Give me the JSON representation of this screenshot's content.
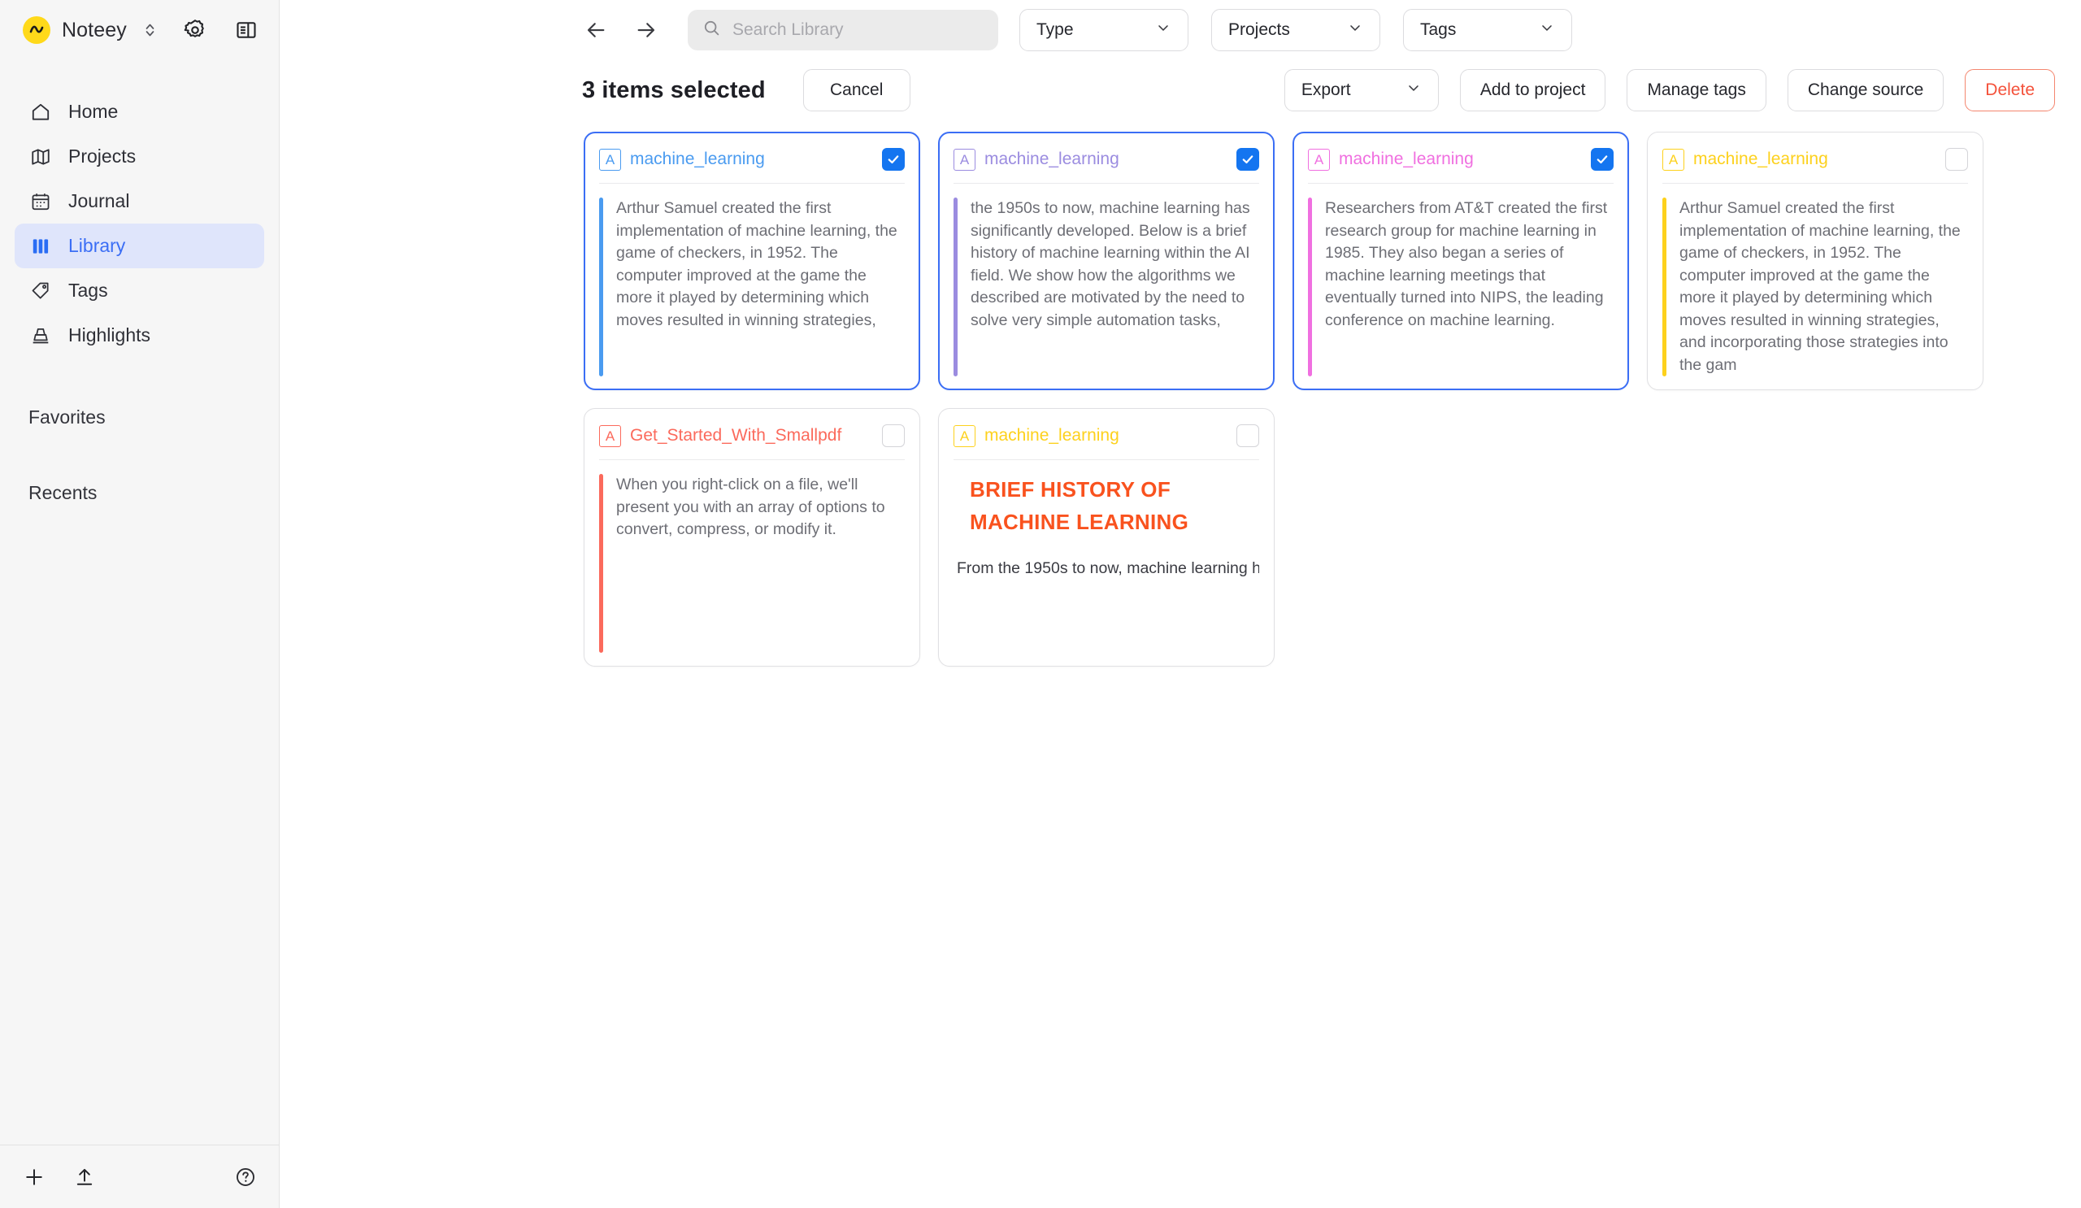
{
  "app": {
    "brand": "Noteey",
    "icons": {
      "brand_logo": "squiggle-logo",
      "brand_switcher": "chevron-up-down-icon",
      "settings": "gear-icon",
      "panel": "toggle-panel-icon",
      "back": "arrow-left-icon",
      "forward": "arrow-right-icon",
      "search": "search-icon",
      "add": "plus-icon",
      "import": "upload-icon",
      "help": "help-circle-icon"
    }
  },
  "sidebar": {
    "items": [
      {
        "label": "Home",
        "icon": "home-icon",
        "active": false
      },
      {
        "label": "Projects",
        "icon": "map-icon",
        "active": false
      },
      {
        "label": "Journal",
        "icon": "calendar-icon",
        "active": false
      },
      {
        "label": "Library",
        "icon": "books-icon",
        "active": true
      },
      {
        "label": "Tags",
        "icon": "tag-icon",
        "active": false
      },
      {
        "label": "Highlights",
        "icon": "highlighter-icon",
        "active": false
      }
    ],
    "sections": [
      {
        "label": "Favorites"
      },
      {
        "label": "Recents"
      }
    ]
  },
  "search": {
    "placeholder": "Search Library",
    "value": ""
  },
  "filters": [
    {
      "label": "Type"
    },
    {
      "label": "Projects"
    },
    {
      "label": "Tags"
    }
  ],
  "selection_bar": {
    "count_label": "3 items selected",
    "cancel_label": "Cancel",
    "export_label": "Export",
    "add_to_project_label": "Add to project",
    "manage_tags_label": "Manage tags",
    "change_source_label": "Change source",
    "delete_label": "Delete"
  },
  "colors": {
    "accent_blue": "#3b6ef5",
    "checkbox_blue": "#1475f0",
    "delete_red": "#f4523b",
    "logo_yellow": "#ffd91a",
    "sidebar_bg": "#f6f6f6",
    "active_nav_bg": "#dfe5fb"
  },
  "cards": [
    {
      "badge": "A",
      "title": "machine_learning",
      "color": "#4a9bf0",
      "selected": true,
      "kind": "quote",
      "text": "Arthur Samuel created the first implementation of machine learning, the game of checkers, in 1952. The computer improved at the game the more it played by determining which moves resulted in winning strategies,"
    },
    {
      "badge": "A",
      "title": "machine_learning",
      "color": "#9b8ce0",
      "selected": true,
      "kind": "quote",
      "text": "the 1950s to now, machine learning has significantly developed. Below is a brief history of machine learning within the AI field. We show how the algorithms we described are motivated by the need to solve very simple automation tasks,"
    },
    {
      "badge": "A",
      "title": "machine_learning",
      "color": "#f06fe0",
      "selected": true,
      "kind": "quote",
      "text": "Researchers from AT&T created the first research group for machine learning in 1985. They also began a series of machine learning meetings that eventually turned into NIPS, the leading conference on machine learning."
    },
    {
      "badge": "A",
      "title": "machine_learning",
      "color": "#fdd11d",
      "selected": false,
      "kind": "quote",
      "text": "Arthur Samuel created the first implementation of machine learning, the game of checkers, in 1952. The computer improved at the game the more it played by determining which moves resulted in winning strategies, and incorporating those strategies into the gam"
    },
    {
      "badge": "A",
      "title": "Get_Started_With_Smallpdf",
      "color": "#fb6a5c",
      "selected": false,
      "kind": "quote",
      "text": "When you right-click on a file, we'll present you with an array of options to convert, compress, or modify it."
    },
    {
      "badge": "A",
      "title": "machine_learning",
      "color": "#fdd11d",
      "selected": false,
      "kind": "heading",
      "heading": "BRIEF HISTORY OF MACHINE LEARNING",
      "heading_color": "#f9521e",
      "subline": "From the 1950s to now, machine learning h"
    }
  ]
}
